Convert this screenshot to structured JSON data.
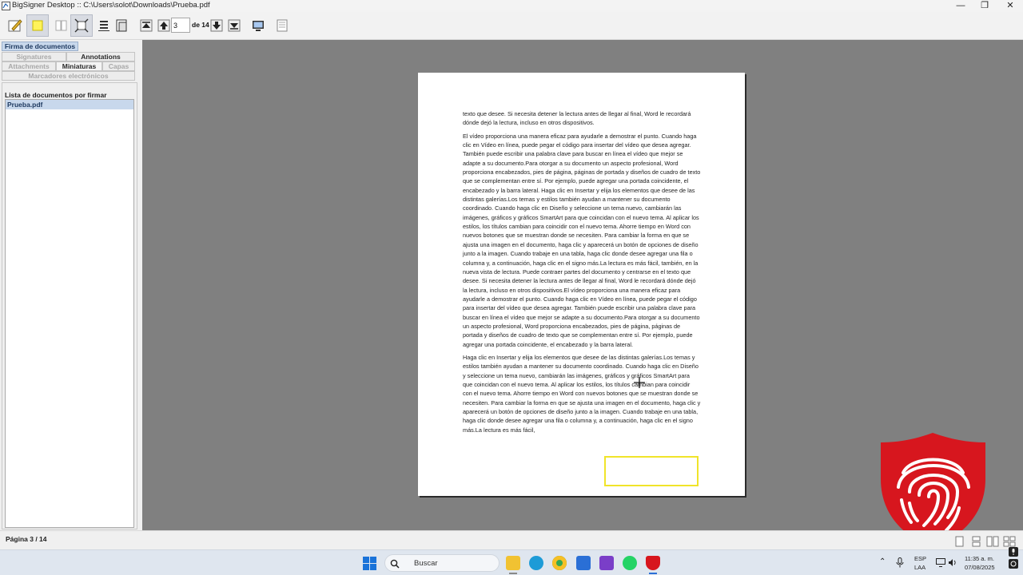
{
  "window": {
    "title": "BigSigner Desktop :: C:\\Users\\solot\\Downloads\\Prueba.pdf",
    "controls": [
      "—",
      "❐",
      "✕"
    ]
  },
  "toolbar": {
    "current_page": "3",
    "page_of": "de 14",
    "icons": [
      "edit-icon",
      "highlight-icon",
      "single-page-icon",
      "fit-page-icon",
      "fit-width-icon",
      "two-page-icon",
      "first-page-icon",
      "previous-page-icon",
      "next-page-icon",
      "last-page-icon",
      "fullscreen-icon",
      "print-icon"
    ]
  },
  "sidebar": {
    "tabs": {
      "signing": "Firma de documentos",
      "signatures": "Signatures",
      "annotations": "Annotations",
      "attachments": "Attachments",
      "thumbnails": "Miniaturas",
      "layers": "Capas",
      "bookmarks": "Marcadores electrónicos"
    },
    "docs_label": "Lista de documentos por firmar",
    "documents": [
      "Prueba.pdf"
    ]
  },
  "document": {
    "paragraphs": [
      "texto que desee. Si necesita detener la lectura antes de llegar al final, Word le recordará dónde dejó la lectura, incluso en otros dispositivos.",
      "El vídeo proporciona una manera eficaz para ayudarle a demostrar el punto. Cuando haga clic en Vídeo en línea, puede pegar el código para insertar del vídeo que desea agregar. También puede escribir una palabra clave para buscar en línea el vídeo que mejor se adapte a su documento.Para otorgar a su documento un aspecto profesional, Word proporciona encabezados, pies de página, páginas de portada y diseños de cuadro de texto que se complementan entre sí. Por ejemplo, puede agregar una portada coincidente, el encabezado y la barra lateral. Haga clic en Insertar y elija los elementos que desee de las distintas galerías.Los temas y estilos también ayudan a mantener su documento coordinado. Cuando haga clic en Diseño y seleccione un tema nuevo, cambiarán las imágenes, gráficos y gráficos SmartArt para que coincidan con el nuevo tema. Al aplicar los estilos, los títulos cambian para coincidir con el nuevo tema. Ahorre tiempo en Word con nuevos botones que se muestran donde se necesiten. Para cambiar la forma en que se ajusta una imagen en el documento, haga clic y aparecerá un botón de opciones de diseño junto a la imagen. Cuando trabaje en una tabla, haga clic donde desee agregar una fila o columna y, a continuación, haga clic en el signo más.La lectura es más fácil, también, en la nueva vista de lectura. Puede contraer partes del documento y centrarse en el texto que desee. Si necesita detener la lectura antes de llegar al final, Word le recordará dónde dejó la lectura, incluso en otros dispositivos.El vídeo proporciona una manera eficaz para ayudarle a demostrar el punto. Cuando haga clic en Vídeo en línea, puede pegar el código para insertar del vídeo que desea agregar. También puede escribir una palabra clave para buscar en línea el vídeo que mejor se adapte a su documento.Para otorgar a su documento un aspecto profesional, Word proporciona encabezados, pies de página, páginas de portada y diseños de cuadro de texto que se complementan entre sí. Por ejemplo, puede agregar una portada coincidente, el encabezado y la barra lateral.",
      "Haga clic en Insertar y elija los elementos que desee de las distintas galerías.Los temas y estilos también ayudan a mantener su documento coordinado. Cuando haga clic en Diseño y seleccione un tema nuevo, cambiarán las imágenes, gráficos y gráficos SmartArt para que coincidan con el nuevo tema. Al aplicar los estilos, los títulos cambian para coincidir con el nuevo tema. Ahorre tiempo en Word con nuevos botones que se muestran donde se necesiten. Para cambiar la forma en que se ajusta una imagen en el documento, haga clic y aparecerá un botón de opciones de diseño junto a la imagen. Cuando trabaje en una tabla, haga clic donde desee agregar una fila o columna y, a continuación, haga clic en el signo más.La lectura es más fácil,"
    ]
  },
  "status": {
    "page_text": "Página 3 / 14"
  },
  "taskbar": {
    "search_placeholder": "Buscar",
    "language": "ESP",
    "keyboard": "LAA",
    "time": "11:35 a. m.",
    "date": "07/08/2025"
  },
  "colors": {
    "viewer_bg": "#808080",
    "signature_box": "#f0e42a",
    "logo_red": "#d7161e",
    "selected_tab": "#c8d8ec"
  }
}
